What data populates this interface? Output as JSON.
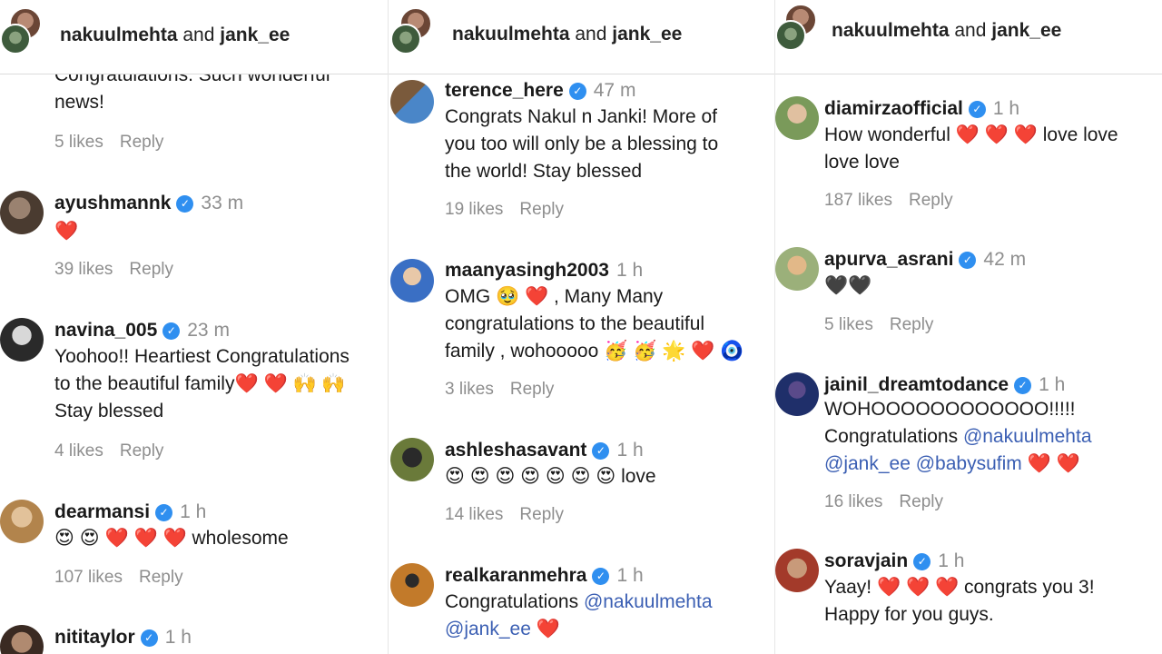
{
  "header": {
    "user1": "nakuulmehta",
    "and": "and",
    "user2": "jank_ee"
  },
  "reply_label": "Reply",
  "verified_glyph": "✓",
  "panels": [
    {
      "partial_text": "Congratulations. Such wonderful\nnews!",
      "partial_likes": "5 likes",
      "comments": [
        {
          "user": "ayushmannk",
          "time": "33 m",
          "text": "❤️",
          "likes": "39 likes"
        },
        {
          "user": "navina_005",
          "time": "23 m",
          "text": "Yoohoo!! Heartiest Congratulations\nto the beautiful family❤️ ❤️ 🙌 🙌\nStay blessed",
          "likes": "4 likes"
        },
        {
          "user": "dearmansi",
          "time": "1 h",
          "text": "😍 😍 ❤️ ❤️ ❤️  wholesome",
          "likes": "107 likes"
        },
        {
          "user": "nititaylor",
          "time": "1 h",
          "text": "",
          "likes": ""
        }
      ]
    },
    {
      "comments": [
        {
          "user": "terence_here",
          "time": "47 m",
          "text": "Congrats Nakul n Janki! More of\nyou too will only be a blessing to\nthe world! Stay blessed",
          "likes": "19 likes"
        },
        {
          "user": "maanyasingh2003",
          "time": "1 h",
          "text": "OMG 🥹 ❤️ , Many Many\ncongratulations to the beautiful\nfamily , wohooooo 🥳 🥳 🌟 ❤️  🧿",
          "likes": "3 likes"
        },
        {
          "user": "ashleshasavant",
          "time": "1 h",
          "text": "😍 😍 😍 😍 😍 😍 😍  love",
          "likes": "14 likes"
        },
        {
          "user": "realkaranmehra",
          "time": "1 h",
          "text_parts": [
            "Congratulations ",
            "@nakuulmehta",
            "\n",
            "@jank_ee",
            " ❤️"
          ],
          "likes": ""
        }
      ]
    },
    {
      "comments": [
        {
          "user": "diamirzaofficial",
          "time": "1 h",
          "text": "How wonderful  ❤️ ❤️ ❤️  love love\nlove love",
          "likes": "187 likes"
        },
        {
          "user": "apurva_asrani",
          "time": "42 m",
          "text": "🖤🖤",
          "likes": "5 likes"
        },
        {
          "user": "jainil_dreamtodance",
          "time": "1 h",
          "text_parts": [
            "WOHOOOOOOOOOOOO!!!!!\nCongratulations ",
            "@nakuulmehta",
            "\n",
            "@jank_ee",
            " ",
            "@babysufim",
            "  ❤️ ❤️"
          ],
          "likes": "16 likes"
        },
        {
          "user": "soravjain",
          "time": "1 h",
          "text": "Yaay!  ❤️ ❤️ ❤️  congrats you 3!\nHappy for you guys.",
          "likes": ""
        }
      ]
    }
  ],
  "avatar_colors": [
    "#5a4a3a",
    "#8f7560",
    "#2b2b2b",
    "#b89a6a",
    "#3a2f2a",
    "#6d5a48",
    "#4a78c2",
    "#2d3a2a",
    "#7a5a3c",
    "#9bb07a",
    "#c7a24a",
    "#1f2f6a",
    "#a33a2a"
  ]
}
